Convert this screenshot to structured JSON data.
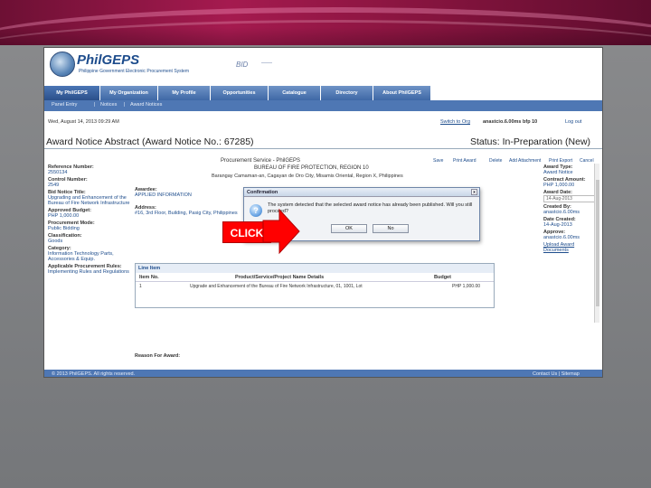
{
  "colors": {
    "brand": "#1d4c8c",
    "nav": "#3e68a6",
    "banner": "#8c1541",
    "callout": "#ff0000"
  },
  "header": {
    "brand": "PhilGEPS",
    "subtitle": "Philippine Government Electronic Procurement System",
    "mark": "BID",
    "mark2": "——"
  },
  "nav": {
    "tabs": [
      "My PhilGEPS",
      "My Organization",
      "My Profile",
      "Opportunities",
      "Catalogue",
      "Directory",
      "About PhilGEPS"
    ]
  },
  "subnav": {
    "items": [
      "Panel Entry",
      "|",
      "Notices",
      "|",
      "Award Notices"
    ]
  },
  "topbar": {
    "date": "Wed, August 14, 2013 09:29 AM",
    "user_link": "Switch to Org",
    "uname": "anastcio.6.00ms   bfp 10",
    "logout": "Log out"
  },
  "page": {
    "title": "Award Notice Abstract (Award Notice No.: 67285)",
    "status": "Status: In-Preparation (New)"
  },
  "toolbar": {
    "items": [
      "Save",
      "Print Award",
      "Delete",
      "Add Attachment",
      "Print Export",
      "Cancel"
    ]
  },
  "org": {
    "line1": "Procurement Service - PhilGEPS",
    "line2": "BUREAU OF FIRE PROTECTION, REGION 10",
    "line3": "Barangay Camaman-an, Cagayan de Oro City, Misamis Oriental, Region X, Philippines"
  },
  "left_fields": [
    {
      "label": "Reference Number:",
      "value": "2550134"
    },
    {
      "label": "Control Number:",
      "value": "2549"
    },
    {
      "label": "Bid Notice Title:",
      "value": "Upgrading and Enhancement of the Bureau of Fire Network Infrastructure"
    },
    {
      "label": "Approved Budget:",
      "value": "PHP 1,000.00"
    },
    {
      "label": "Procurement Mode:",
      "value": "Public Bidding"
    },
    {
      "label": "Classification:",
      "value": "Goods"
    },
    {
      "label": "Category:",
      "value": "Information Technology Parts, Accessories & Equip."
    },
    {
      "label": "Applicable Procurement Rules:",
      "value": "Implementing Rules and Regulations"
    }
  ],
  "mid_fields": [
    {
      "label": "Awardee:",
      "value": "APPLIED INFORMATION"
    },
    {
      "label": "Address:",
      "value": "#16, 3rd Floor, Building, Pasig City, Philippines"
    }
  ],
  "lineitem": {
    "header": "Line Item",
    "col_item": "Item No.",
    "col_product": "Product/Service/Project Name Details",
    "col_budget": "Budget",
    "row_no": "1",
    "row_desc": "Upgrade and Enhancement of the Bureau of Fire Network Infrastructure, 01, 1001, Lot",
    "row_budget": "PHP 1,000.00"
  },
  "right_fields": [
    {
      "label": "Award Type:",
      "value": "Award Notice"
    },
    {
      "label": "Contract Amount:",
      "value": "PHP 1,000.00"
    },
    {
      "label": "Award Date:",
      "value": "14-Aug-2013"
    },
    {
      "label": "Created By:",
      "value": "anastcio.6.00ms"
    },
    {
      "label": "Date Created:",
      "value": "14-Aug-2013"
    },
    {
      "label": "Approve:",
      "value": "anastcio.6.00ms"
    },
    {
      "label": "",
      "value": "Upload Award Documents"
    }
  ],
  "reason": "Reason For Award:",
  "footer": {
    "copyright": "© 2013 PhilGEPS. All rights reserved.",
    "links": "Contact Us  |  Sitemap"
  },
  "dialog": {
    "title": "Confirmation",
    "close": "x",
    "icon": "?",
    "message": "The system detected that the selected award notice has already been published. Will you still proceed?",
    "ok": "OK",
    "cancel": "No"
  },
  "callout": {
    "label": "CLICK"
  }
}
